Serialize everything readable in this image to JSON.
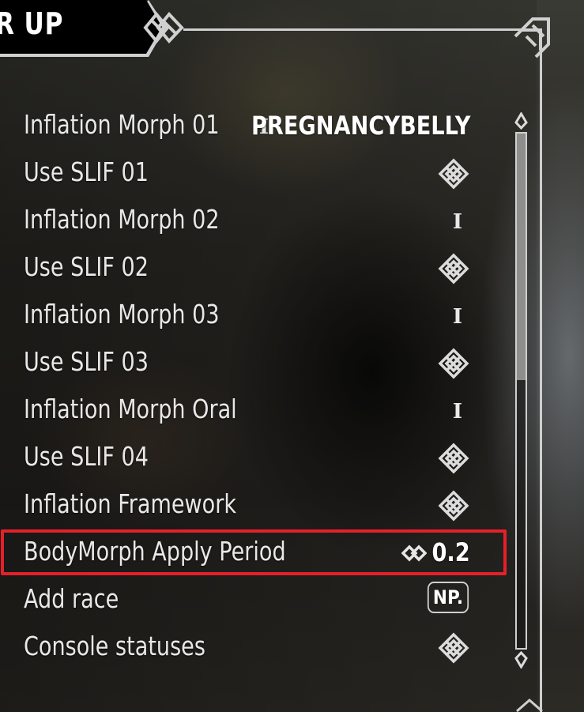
{
  "header": {
    "title": "R UP"
  },
  "rows": [
    {
      "label": "Inflation Morph 01",
      "value": "PREGNANCYBELLY",
      "control": "text-input"
    },
    {
      "label": "Use SLIF 01",
      "control": "checkbox",
      "checked": false
    },
    {
      "label": "Inflation Morph 02",
      "value": "",
      "control": "text-input"
    },
    {
      "label": "Use SLIF 02",
      "control": "checkbox",
      "checked": false
    },
    {
      "label": "Inflation Morph 03",
      "value": "",
      "control": "text-input"
    },
    {
      "label": "Use SLIF 03",
      "control": "checkbox",
      "checked": false
    },
    {
      "label": "Inflation Morph Oral",
      "value": "",
      "control": "text-input"
    },
    {
      "label": "Use SLIF 04",
      "control": "checkbox",
      "checked": false
    },
    {
      "label": "Inflation Framework",
      "control": "checkbox",
      "checked": false
    },
    {
      "label": "BodyMorph Apply Period",
      "value": "0.2",
      "control": "slider",
      "highlighted": true
    },
    {
      "label": "Add race",
      "key": "NP.",
      "control": "keymap"
    },
    {
      "label": "Console statuses",
      "control": "checkbox",
      "checked": false
    }
  ],
  "icons": {
    "checkbox": "knot-checkbox-icon",
    "text": "text-cursor-icon",
    "slider": "slider-diamond-icon"
  },
  "colors": {
    "highlight": "#e5202a",
    "frame": "#cfcfcf",
    "text": "#e8e8e8"
  },
  "scroll": {
    "position_fraction": 0.0,
    "visible_fraction": 0.48
  }
}
